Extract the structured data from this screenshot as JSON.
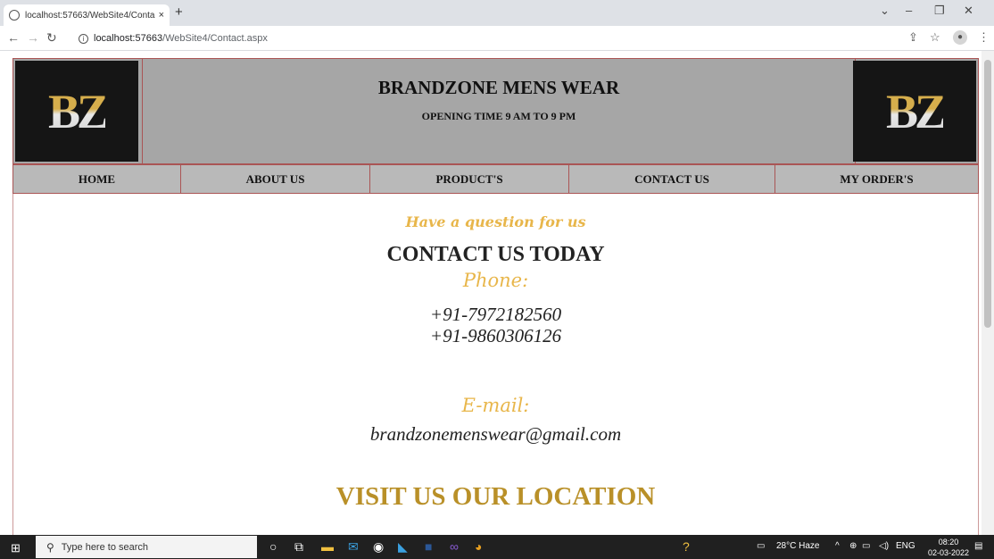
{
  "browser": {
    "tab_title": "localhost:57663/WebSite4/Conta",
    "tab_close": "×",
    "new_tab": "+",
    "url_host": "localhost:57663",
    "url_path": "/WebSite4/Contact.aspx"
  },
  "header": {
    "logo_text": "BZ",
    "brand_title": "BRANDZONE MENS WEAR",
    "brand_subtitle": "OPENING TIME 9 AM TO 9 PM"
  },
  "menu": {
    "items": [
      {
        "label": "HOME"
      },
      {
        "label": "ABOUT US"
      },
      {
        "label": "PRODUCT'S"
      },
      {
        "label": "CONTACT US"
      },
      {
        "label": "MY ORDER'S"
      }
    ]
  },
  "contact": {
    "question": "Have a question for us",
    "title": "CONTACT US TODAY",
    "phone_label": "Phone:",
    "phones": [
      "+91-7972182560",
      "+91-9860306126"
    ],
    "email_label": "E-mail:",
    "email": "brandzonemenswear@gmail.com",
    "visit": "VISIT US OUR LOCATION"
  },
  "taskbar": {
    "search_placeholder": "Type here to search",
    "weather": "28°C Haze",
    "language": "ENG",
    "time": "08:20",
    "date": "02-03-2022"
  },
  "colors": {
    "accent_gold": "#e8b64a",
    "visit_gold": "#b99028",
    "header_gray": "#a6a6a6",
    "border_red": "#aa5555"
  }
}
